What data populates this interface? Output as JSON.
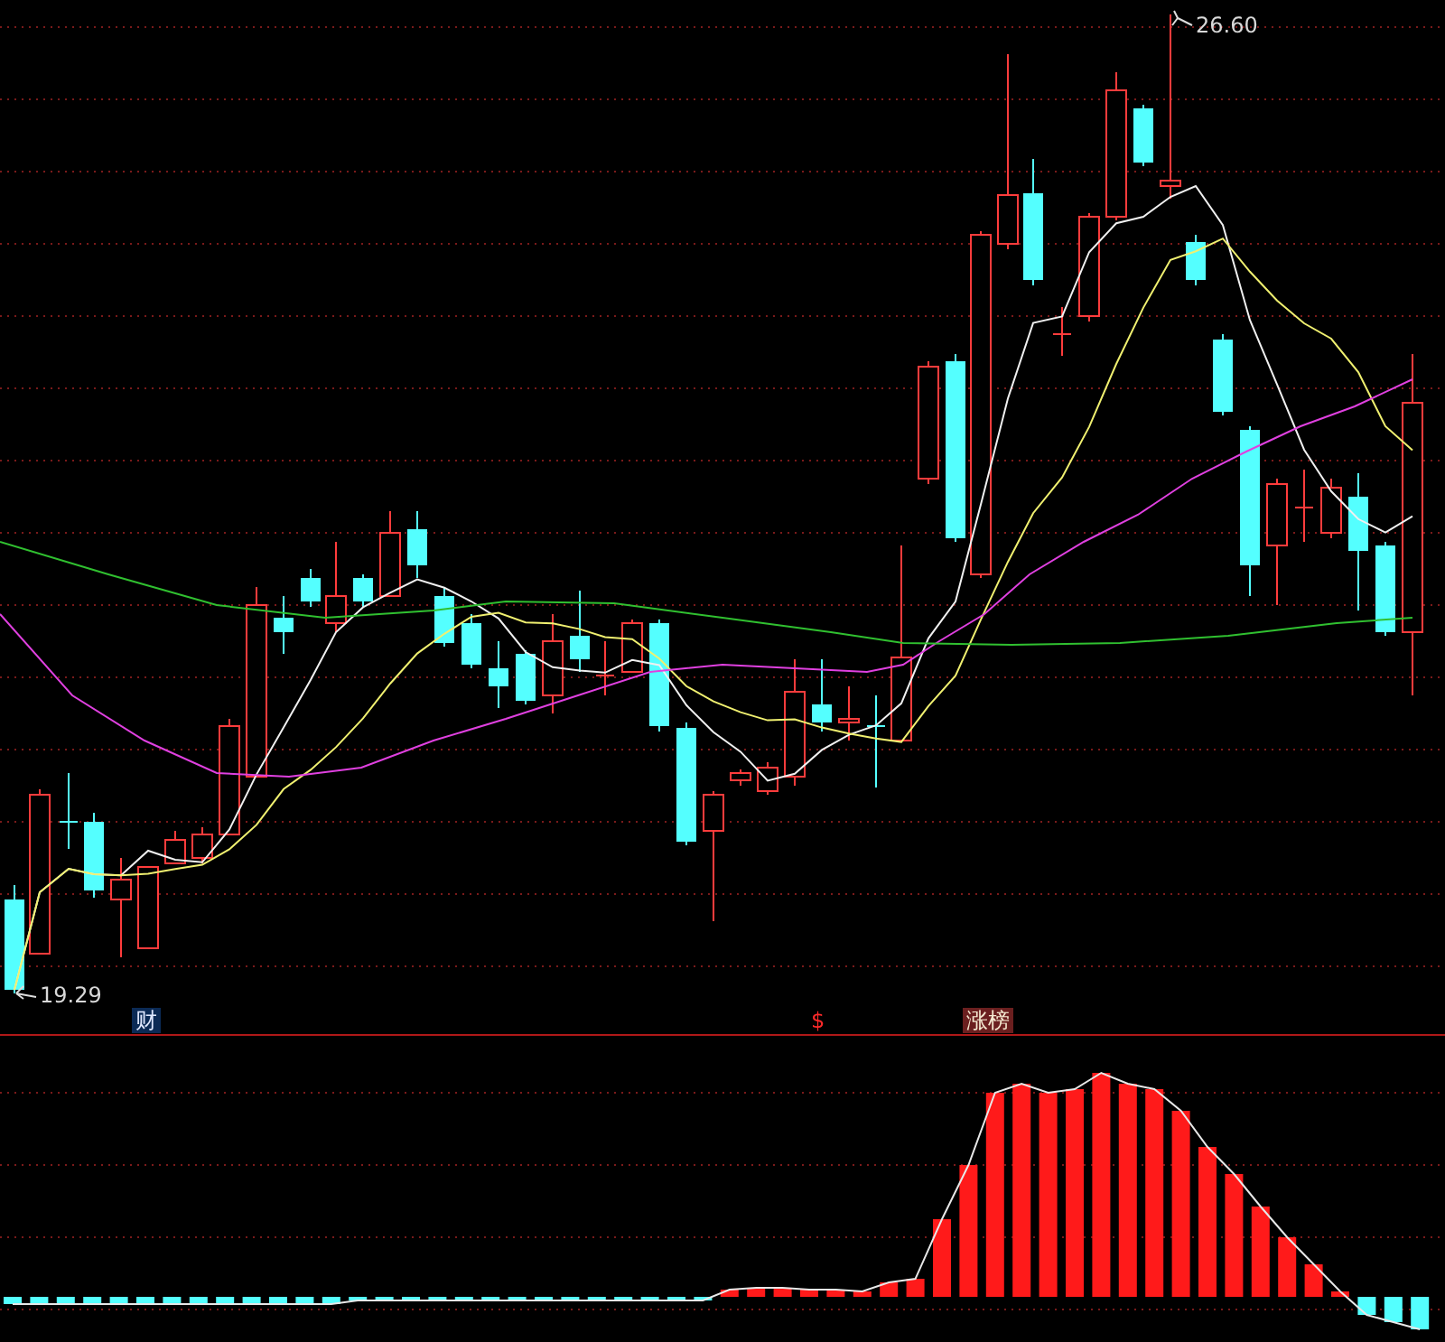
{
  "price_chart": {
    "high_label": "26.60",
    "low_label": "19.29"
  },
  "markers": [
    {
      "text": "财",
      "kind": "finance"
    },
    {
      "text": "$",
      "kind": "dollar"
    },
    {
      "text": "涨榜",
      "kind": "rank"
    }
  ]
}
